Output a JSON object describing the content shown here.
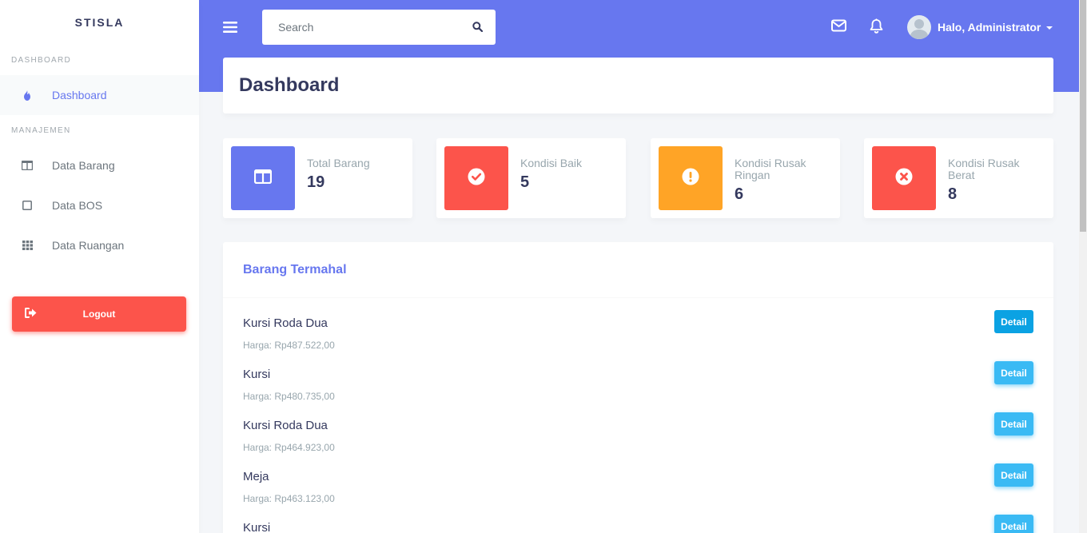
{
  "sidebar": {
    "brand": "STISLA",
    "sections": [
      {
        "header": "DASHBOARD"
      },
      {
        "header": "MANAJEMEN"
      }
    ],
    "items": [
      {
        "label": "Dashboard",
        "icon": "fire-icon",
        "active": true
      },
      {
        "label": "Data Barang",
        "icon": "columns-icon"
      },
      {
        "label": "Data BOS",
        "icon": "square-icon"
      },
      {
        "label": "Data Ruangan",
        "icon": "grid-icon"
      }
    ],
    "logout_label": "Logout"
  },
  "navbar": {
    "search_placeholder": "Search",
    "user_greeting": "Halo, Administrator"
  },
  "page": {
    "title": "Dashboard"
  },
  "stats": [
    {
      "label": "Total Barang",
      "value": "19",
      "color": "#6777ef",
      "icon": "columns-icon"
    },
    {
      "label": "Kondisi Baik",
      "value": "5",
      "color": "#fc544b",
      "icon": "check-circle-icon"
    },
    {
      "label": "Kondisi Rusak Ringan",
      "value": "6",
      "color": "#ffa426",
      "icon": "exclamation-circle-icon"
    },
    {
      "label": "Kondisi Rusak Berat",
      "value": "8",
      "color": "#fc544b",
      "icon": "times-circle-icon"
    }
  ],
  "barang_termahal": {
    "title": "Barang Termahal",
    "button_label": "Detail",
    "items": [
      {
        "name": "Kursi Roda Dua",
        "price": "Harga: Rp487.522,00"
      },
      {
        "name": "Kursi",
        "price": "Harga: Rp480.735,00"
      },
      {
        "name": "Kursi Roda Dua",
        "price": "Harga: Rp464.923,00"
      },
      {
        "name": "Meja",
        "price": "Harga: Rp463.123,00"
      },
      {
        "name": "Kursi",
        "price": ""
      }
    ]
  },
  "colors": {
    "primary": "#6777ef",
    "danger": "#fc544b",
    "warning": "#ffa426",
    "info": "#3abaf4"
  }
}
